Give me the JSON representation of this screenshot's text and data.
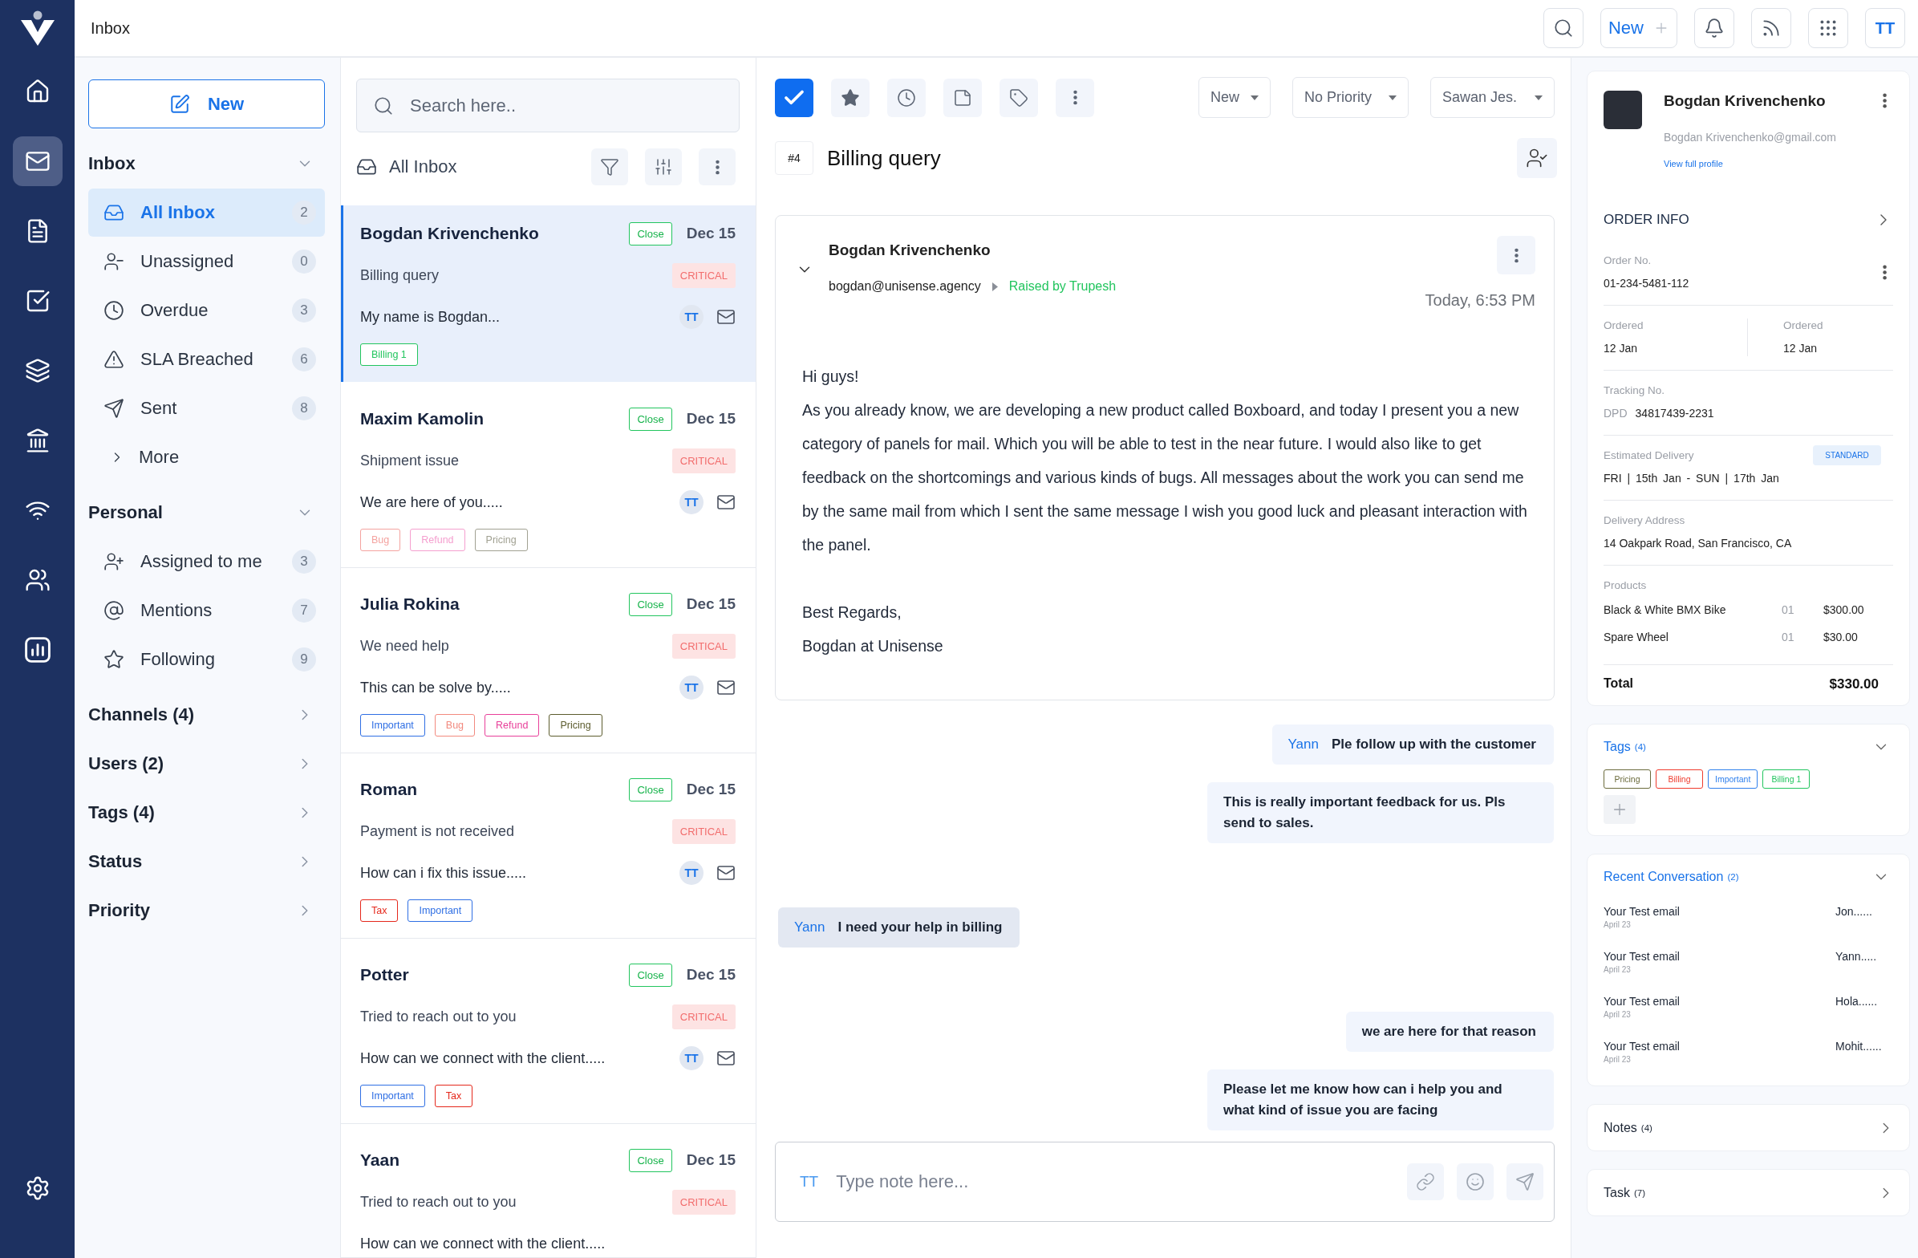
{
  "rail": {
    "items": [
      {
        "selected": false
      },
      {
        "selected": true
      },
      {
        "selected": false
      },
      {
        "selected": false
      },
      {
        "selected": false
      },
      {
        "selected": false
      },
      {
        "selected": false
      },
      {
        "selected": false
      },
      {
        "selected": false
      }
    ]
  },
  "topbar": {
    "title": "Inbox",
    "new_button": "New",
    "avatar": "TT"
  },
  "nav": {
    "new_button": "New",
    "sections": [
      {
        "title": "Inbox",
        "expanded": true,
        "items": [
          {
            "label": "All Inbox",
            "count": "2",
            "selected": true
          },
          {
            "label": "Unassigned",
            "count": "0",
            "selected": false
          },
          {
            "label": "Overdue",
            "count": "3",
            "selected": false
          },
          {
            "label": "SLA Breached",
            "count": "6",
            "selected": false
          },
          {
            "label": "Sent",
            "count": "8",
            "selected": false
          }
        ],
        "more": "More"
      },
      {
        "title": "Personal",
        "expanded": true,
        "items": [
          {
            "label": "Assigned to me",
            "count": "3",
            "selected": false
          },
          {
            "label": "Mentions",
            "count": "7",
            "selected": false
          },
          {
            "label": "Following",
            "count": "9",
            "selected": false
          }
        ]
      },
      {
        "title": "Channels (4)",
        "expanded": false
      },
      {
        "title": "Users (2)",
        "expanded": false
      },
      {
        "title": "Tags (4)",
        "expanded": false
      },
      {
        "title": "Status",
        "expanded": false
      },
      {
        "title": "Priority",
        "expanded": false
      }
    ]
  },
  "list": {
    "search": {
      "placeholder": "Search here.."
    },
    "title": "All Inbox",
    "conversations": [
      {
        "name": "Bogdan Krivenchenko",
        "status": "Close",
        "date": "Dec 15",
        "subject": "Billing query",
        "priority": "CRITICAL",
        "preview": "My name is Bogdan...",
        "avatar": "TT",
        "selected": true,
        "tags": [
          {
            "label": "Billing 1",
            "color": "#22c55e"
          }
        ]
      },
      {
        "name": "Maxim Kamolin",
        "status": "Close",
        "date": "Dec 15",
        "subject": "Shipment issue",
        "priority": "CRITICAL",
        "preview": "We are here of you.....",
        "avatar": "TT",
        "selected": false,
        "tags": [
          {
            "label": "Bug",
            "color": "#f4a3a0"
          },
          {
            "label": "Refund",
            "color": "#f59fcf"
          },
          {
            "label": "Pricing",
            "color": "#a1a192"
          }
        ]
      },
      {
        "name": "Julia Rokina",
        "status": "Close",
        "date": "Dec 15",
        "subject": "We need help",
        "priority": "CRITICAL",
        "preview": "This can be solve by.....",
        "avatar": "TT",
        "selected": false,
        "tags": [
          {
            "label": "Important",
            "color": "#2f6fe4"
          },
          {
            "label": "Bug",
            "color": "#f28a7f"
          },
          {
            "label": "Refund",
            "color": "#e8409a"
          },
          {
            "label": "Pricing",
            "color": "#5c5c2e"
          }
        ]
      },
      {
        "name": "Roman",
        "status": "Close",
        "date": "Dec 15",
        "subject": "Payment is not received",
        "priority": "CRITICAL",
        "preview": "How can i fix this issue.....",
        "avatar": "TT",
        "selected": false,
        "tags": [
          {
            "label": "Tax",
            "color": "#e5281c"
          },
          {
            "label": "Important",
            "color": "#2f6fe4"
          }
        ]
      },
      {
        "name": "Potter",
        "status": "Close",
        "date": "Dec 15",
        "subject": "Tried to reach out to you",
        "priority": "CRITICAL",
        "preview": "How can we connect with the client.....",
        "avatar": "TT",
        "selected": false,
        "tags": [
          {
            "label": "Important",
            "color": "#2f6fe4"
          },
          {
            "label": "Tax",
            "color": "#e5281c"
          }
        ]
      },
      {
        "name": "Yaan",
        "status": "Close",
        "date": "Dec 15",
        "subject": "Tried to reach out to you",
        "priority": "CRITICAL",
        "preview": "How can we connect with the client.....",
        "selected": false
      }
    ]
  },
  "ticket": {
    "filters": [
      {
        "value": "New"
      },
      {
        "value": "No Priority"
      },
      {
        "value": "Sawan Jes."
      }
    ],
    "number": "#4",
    "subject": "Billing query",
    "email": {
      "sender": "Bogdan Krivenchenko",
      "address": "bogdan@unisense.agency",
      "raised_by": "Raised by Trupesh",
      "time": "Today, 6:53 PM",
      "expanded": true,
      "greeting": "Hi guys!",
      "text": "As you already know, we are developing a new product called Boxboard, and today I present you a new category of panels for mail. Which you will be able to test in the near future. I would also like to get feedback on the shortcomings and various kinds of bugs. All messages about the work you can send me by the same mail from which I sent the same message I wish you good luck and pleasant interaction with the panel.",
      "sign_off": [
        "Best Regards,",
        "Bogdan at Unisense"
      ]
    },
    "notes": [
      {
        "kind": "outgoing",
        "author": "Yann",
        "text": "Ple follow up with the customer"
      },
      {
        "kind": "outgoing",
        "text": "This is really important feedback for us. Pls send to sales."
      },
      {
        "kind": "incoming",
        "author": "Yann",
        "text": "I need your help in billing"
      },
      {
        "kind": "outgoing",
        "text": "we are here for that reason"
      },
      {
        "kind": "outgoing",
        "text": "Please let me know how can i help you and what kind of issue you are facing"
      }
    ],
    "composer": {
      "avatar": "TT",
      "placeholder": "Type note here..."
    }
  },
  "customer": {
    "name": "Bogdan Krivenchenko",
    "email": "Bogdan Krivenchenko@gmail.com",
    "link": "View full profile"
  },
  "order": {
    "title": "ORDER INFO",
    "order_no": {
      "label": "Order No.",
      "value": "01-234-5481-112"
    },
    "dates": [
      {
        "label": "Ordered",
        "value": "12 Jan"
      },
      {
        "label": "Ordered",
        "value": "12 Jan"
      }
    ],
    "tracking": {
      "label": "Tracking No.",
      "carrier": "DPD",
      "value": "34817439-2231"
    },
    "delivery": {
      "label": "Estimated Delivery",
      "badge": "STANDARD",
      "value": "FRI | 15th Jan - SUN | 17th Jan"
    },
    "address": {
      "label": "Delivery Address",
      "value": "14 Oakpark Road, San Francisco, CA"
    },
    "products": {
      "label": "Products",
      "items": [
        {
          "name": "Black & White BMX Bike",
          "qty": "01",
          "price": "$300.00"
        },
        {
          "name": "Spare Wheel",
          "qty": "01",
          "price": "$30.00"
        }
      ]
    },
    "total": {
      "label": "Total",
      "value": "$330.00"
    }
  },
  "tags_panel": {
    "title": "Tags",
    "count": "(4)",
    "expanded": true,
    "tags": [
      {
        "label": "Pricing",
        "color": "#6b6b3c"
      },
      {
        "label": "Billing",
        "color": "#ef3b2d"
      },
      {
        "label": "Important",
        "color": "#2f80ed"
      },
      {
        "label": "Billing 1",
        "color": "#22c55e"
      }
    ]
  },
  "recent": {
    "title": "Recent Conversation",
    "count": "(2)",
    "expanded": true,
    "items": [
      {
        "subject": "Your Test email",
        "date": "April 23",
        "from": "Jon......"
      },
      {
        "subject": "Your Test email",
        "date": "April 23",
        "from": "Yann....."
      },
      {
        "subject": "Your Test email",
        "date": "April 23",
        "from": "Hola......"
      },
      {
        "subject": "Your Test email",
        "date": "April 23",
        "from": "Mohit......"
      }
    ]
  },
  "sections": [
    {
      "title": "Notes",
      "count": "(4)",
      "expanded": false
    },
    {
      "title": "Task",
      "count": "(7)",
      "expanded": false
    }
  ]
}
